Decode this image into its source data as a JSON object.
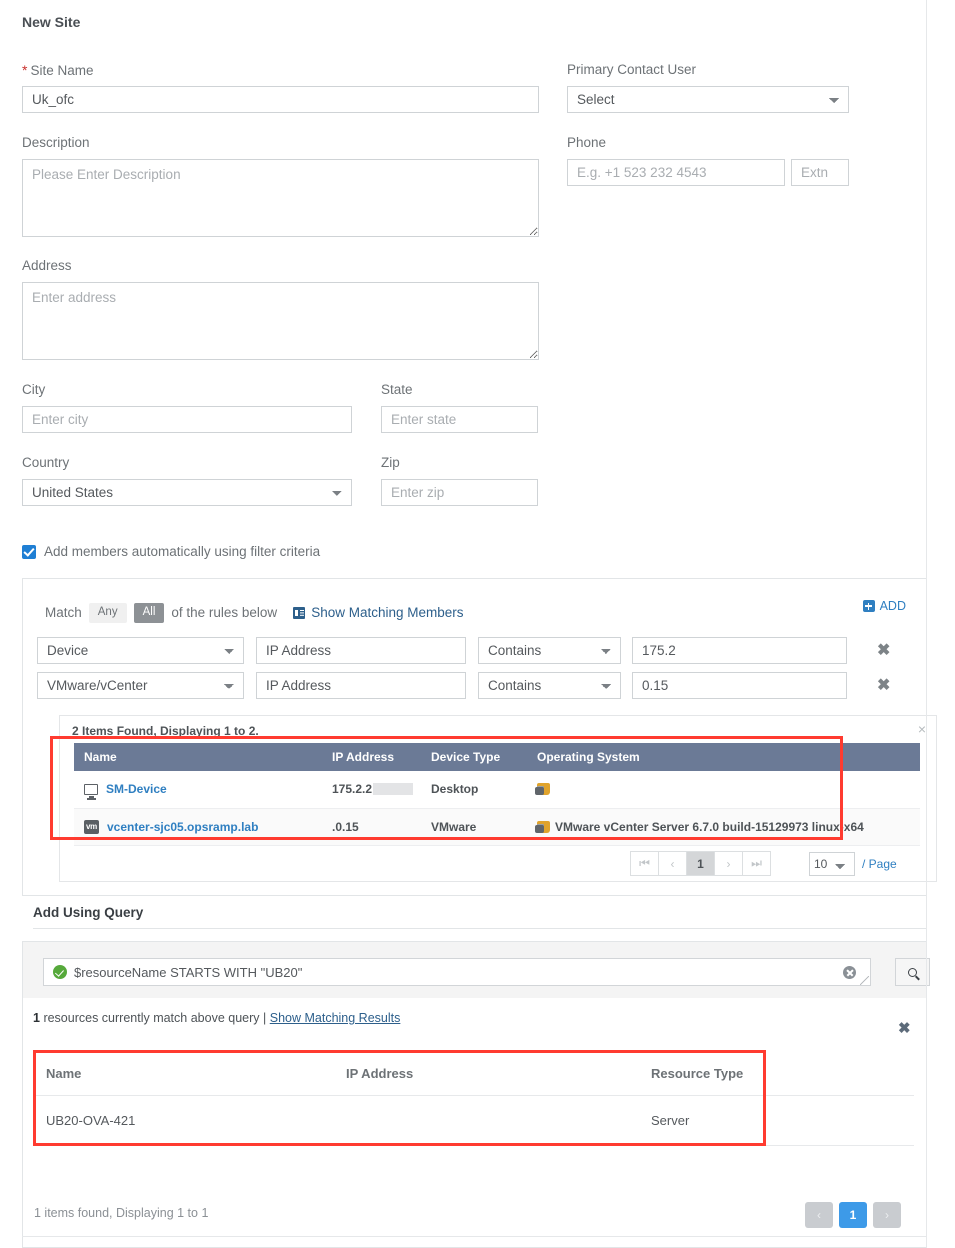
{
  "page": {
    "title": "New Site"
  },
  "form": {
    "site_name": {
      "label": "Site Name",
      "required_mark": "*",
      "value": "Uk_ofc"
    },
    "description": {
      "label": "Description",
      "placeholder": "Please Enter Description",
      "value": ""
    },
    "address": {
      "label": "Address",
      "placeholder": "Enter address",
      "value": ""
    },
    "city": {
      "label": "City",
      "placeholder": "Enter city",
      "value": ""
    },
    "state": {
      "label": "State",
      "placeholder": "Enter state",
      "value": ""
    },
    "country": {
      "label": "Country",
      "value": "United States"
    },
    "zip": {
      "label": "Zip",
      "placeholder": "Enter zip",
      "value": ""
    },
    "primary_contact_user": {
      "label": "Primary Contact User",
      "value": "Select"
    },
    "phone": {
      "label": "Phone",
      "placeholder": "E.g. +1 523 232 4543",
      "value": ""
    },
    "extn": {
      "placeholder": "Extn",
      "value": ""
    }
  },
  "auto_members": {
    "checkbox_label": "Add members automatically using filter criteria",
    "checked": true
  },
  "filter": {
    "match_prefix": "Match",
    "match_any": "Any",
    "match_all": "All",
    "match_suffix": "of the rules below",
    "show_matching_members": "Show Matching Members",
    "add_label": "ADD",
    "remove_label": "✖",
    "rules": [
      {
        "entity": "Device",
        "field": "IP Address",
        "operator": "Contains",
        "value": "175.2"
      },
      {
        "entity": "VMware/vCenter",
        "field": "IP Address",
        "operator": "Contains",
        "value": "0.15"
      }
    ]
  },
  "members_results": {
    "count_text": "2 Items Found, Displaying 1 to 2.",
    "close_label": "×",
    "columns": [
      "Name",
      "IP Address",
      "Device Type",
      "Operating System"
    ],
    "rows": [
      {
        "icon": "monitor-icon",
        "name": "SM-Device",
        "ip": "175.2.2",
        "ip_redacted": true,
        "device_type": "Desktop",
        "os": "",
        "os_icon": true
      },
      {
        "icon": "vm-icon",
        "name": "vcenter-sjc05.opsramp.lab",
        "ip": ".0.15",
        "ip_redacted": false,
        "device_type": "VMware",
        "os": "VMware vCenter Server 6.7.0 build-15129973 linux-x64",
        "os_icon": true
      }
    ],
    "pagination": {
      "first": "⏮",
      "prev": "‹",
      "current": "1",
      "next": "›",
      "last": "⏭",
      "per_page": "10",
      "per_page_label": "/ Page"
    }
  },
  "query_section": {
    "title": "Add Using Query",
    "query_value": "$resourceName STARTS WITH \"UB20\"",
    "valid": true,
    "clear_icon": "clear-circle-icon",
    "search_icon": "search-icon",
    "match_count": "1",
    "match_text": "resources currently match above query",
    "separator": "|",
    "show_matching_results": "Show Matching Results",
    "close_label": "✖",
    "columns": [
      "Name",
      "IP Address",
      "Resource Type"
    ],
    "rows": [
      {
        "name": "UB20-OVA-421",
        "ip": "",
        "resource_type": "Server"
      }
    ],
    "footer_text": "1 items found, Displaying 1 to 1",
    "pagination": {
      "prev": "‹",
      "current": "1",
      "next": "›"
    }
  },
  "colors": {
    "accent_blue": "#2f7fc1",
    "active_page_blue": "#3d9ae8",
    "table_header": "#6b7a96",
    "highlight_red": "#ff3b30",
    "valid_green": "#56a93b"
  }
}
